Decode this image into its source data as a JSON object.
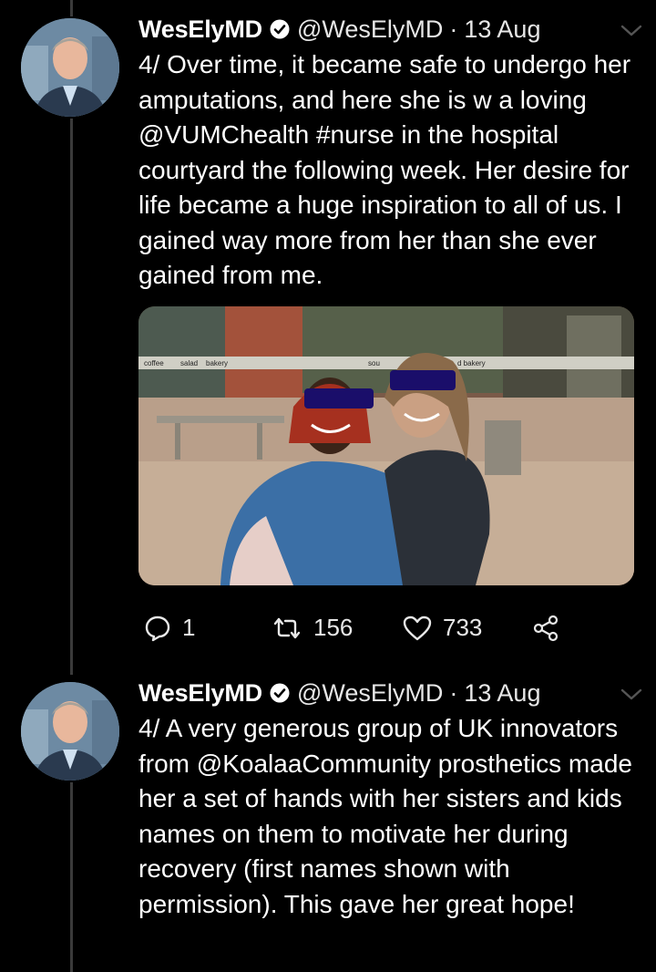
{
  "tweets": [
    {
      "display_name": "WesElyMD",
      "handle": "@WesElyMD",
      "separator": "·",
      "date": "13 Aug",
      "text_parts": [
        "4/ Over time, it became safe to undergo her amputations, and here she is w a loving ",
        "@VUMChealth",
        " ",
        "#nurse",
        " in the hospital courtyard the following week. Her desire for life became a huge inspiration to all of us. I gained way more from her than she ever gained from me."
      ],
      "photo": {
        "signs": [
          "coffee",
          "salad",
          "bakery",
          "sou",
          "d bakery"
        ]
      },
      "actions": {
        "replies": "1",
        "retweets": "156",
        "likes": "733"
      }
    },
    {
      "display_name": "WesElyMD",
      "handle": "@WesElyMD",
      "separator": "·",
      "date": "13 Aug",
      "text_parts": [
        "4/ A very generous group of UK innovators from ",
        "@KoalaaCommunity",
        " prosthetics made her a set of hands with her sisters and kids names on them to motivate her during recovery (first names shown with permission). This gave her great hope!"
      ]
    }
  ],
  "icons": {
    "verified": "verified-badge-icon",
    "chevron": "chevron-down-icon",
    "reply": "reply-icon",
    "retweet": "retweet-icon",
    "like": "heart-icon",
    "share": "share-icon"
  },
  "colors": {
    "background": "#000000",
    "thread_line": "#3a3a3a",
    "text": "#ffffff",
    "meta": "#e7e7e7"
  }
}
